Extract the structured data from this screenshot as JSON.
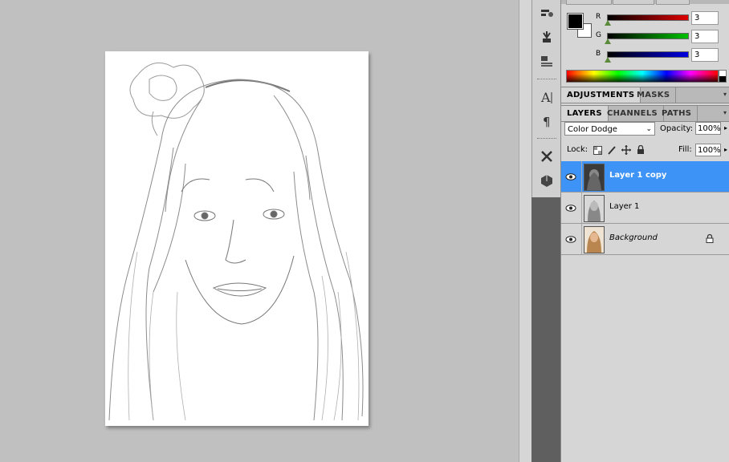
{
  "canvas": {
    "document_name": "sketch portrait"
  },
  "color_panel": {
    "channels": [
      {
        "label": "R",
        "value": "3",
        "color": "#e00000"
      },
      {
        "label": "G",
        "value": "3",
        "color": "#00c000"
      },
      {
        "label": "B",
        "value": "3",
        "color": "#0000e0"
      }
    ]
  },
  "adjustments_tabs": [
    {
      "label": "ADJUSTMENTS"
    },
    {
      "label": "MASKS"
    }
  ],
  "layers_tabs": [
    {
      "label": "LAYERS"
    },
    {
      "label": "CHANNELS"
    },
    {
      "label": "PATHS"
    }
  ],
  "layers_panel": {
    "blend_mode": "Color Dodge",
    "opacity_label": "Opacity:",
    "opacity_value": "100%",
    "lock_label": "Lock:",
    "fill_label": "Fill:",
    "fill_value": "100%",
    "layers": [
      {
        "name": "Layer 1 copy",
        "selected": true
      },
      {
        "name": "Layer 1",
        "selected": false
      },
      {
        "name": "Background",
        "selected": false,
        "italic": true,
        "locked": true
      }
    ]
  },
  "colors": {
    "selection": "#3d94f6",
    "panel_bg": "#d6d6d6",
    "canvas_bg": "#c0c0c0"
  }
}
